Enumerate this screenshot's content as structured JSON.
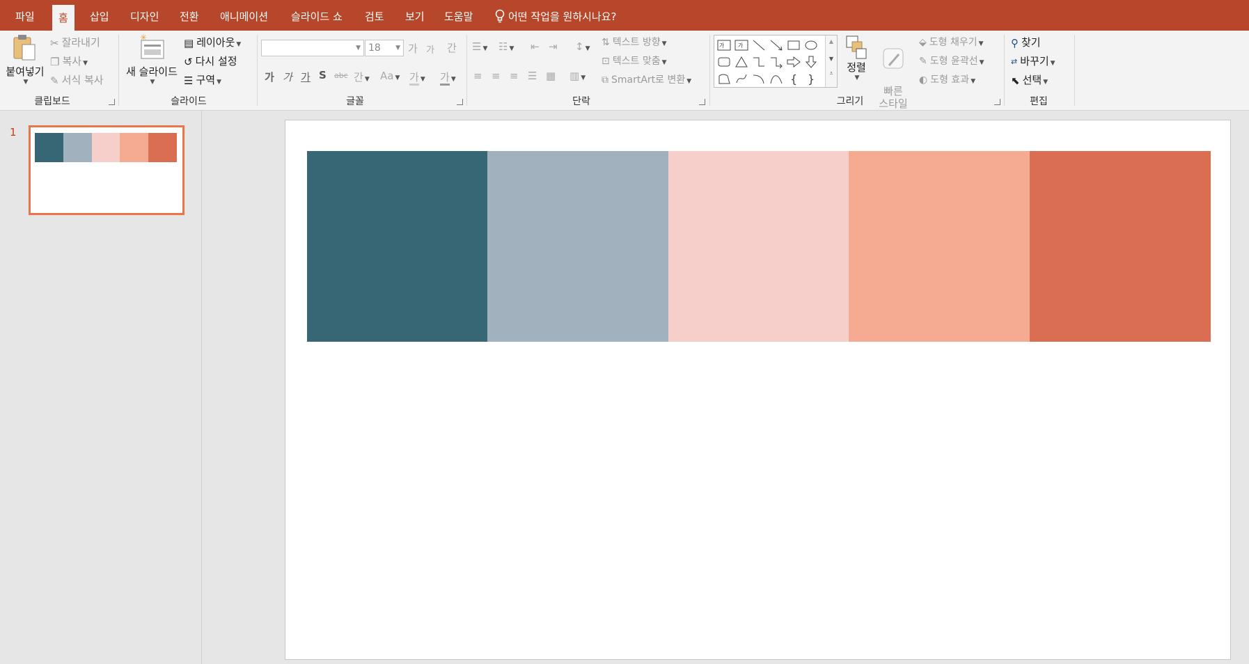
{
  "tabs": [
    "파일",
    "홈",
    "삽입",
    "디자인",
    "전환",
    "애니메이션",
    "슬라이드 쇼",
    "검토",
    "보기",
    "도움말"
  ],
  "active_tab": "홈",
  "tell_me": "어떤 작업을 원하시나요?",
  "clipboard": {
    "label": "클립보드",
    "paste": "붙여넣기",
    "cut": "잘라내기",
    "copy": "복사",
    "format_painter": "서식 복사"
  },
  "slides_group": {
    "label": "슬라이드",
    "new_slide": "새 슬라이드",
    "layout": "레이아웃",
    "reset": "다시 설정",
    "section": "구역"
  },
  "font": {
    "label": "글꼴",
    "name": "",
    "size": "18",
    "grow": "가",
    "shrink": "가",
    "bold": "가",
    "italic": "가",
    "underline": "가",
    "shadow": "S",
    "strike": "abc",
    "spacing": "간",
    "case": "Aa",
    "highlight": "가",
    "color": "가"
  },
  "paragraph": {
    "label": "단락",
    "text_direction": "텍스트 방향",
    "align_text": "텍스트 맞춤",
    "smartart": "SmartArt로 변환"
  },
  "drawing": {
    "label": "그리기",
    "arrange": "정렬",
    "quick_styles": "빠른\n스타일",
    "shape_fill": "도형 채우기",
    "shape_outline": "도형 윤곽선",
    "shape_effects": "도형 효과"
  },
  "editing": {
    "label": "편집",
    "find": "찾기",
    "replace": "바꾸기",
    "select": "선택"
  },
  "slides": [
    {
      "number": "1"
    }
  ],
  "palette": [
    "#376674",
    "#a1b2be",
    "#f6cfca",
    "#f4ab91",
    "#d96e52"
  ],
  "colors": {
    "accent": "#b7472a",
    "thumb_border": "#e97548"
  }
}
